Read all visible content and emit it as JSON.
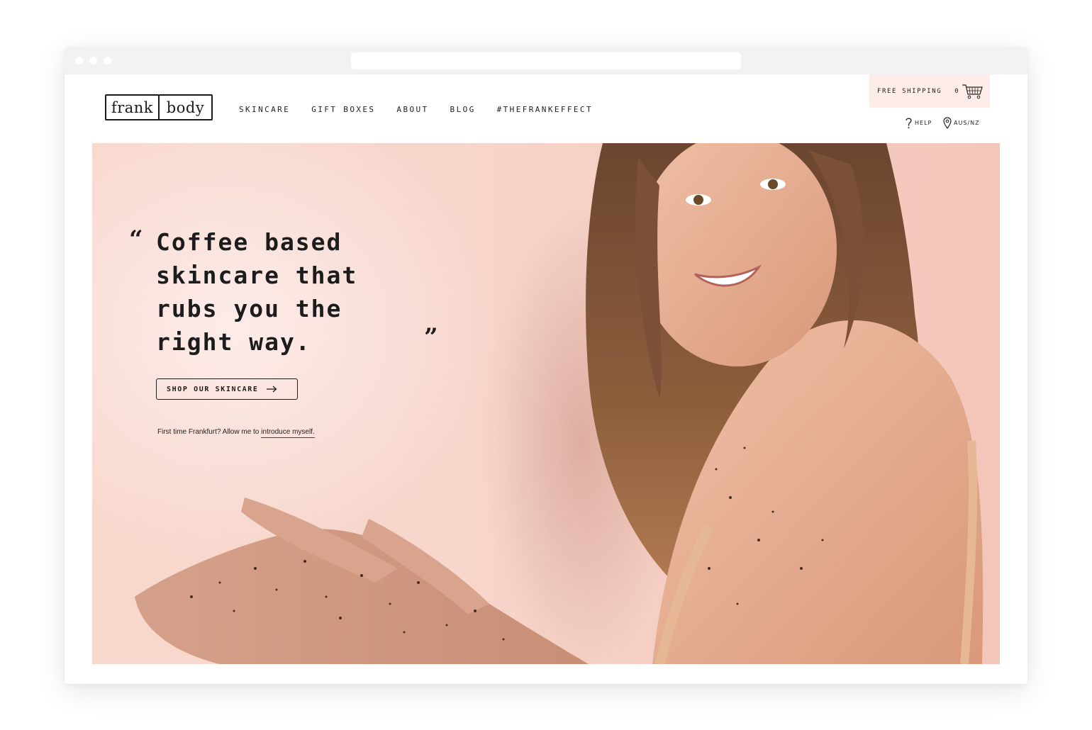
{
  "browser": {
    "address": ""
  },
  "header": {
    "logo": {
      "left": "frank",
      "right": "body"
    },
    "nav": [
      {
        "label": "SKINCARE"
      },
      {
        "label": "GIFT BOXES"
      },
      {
        "label": "ABOUT"
      },
      {
        "label": "BLOG"
      },
      {
        "label": "#THEFRANKEFFECT"
      }
    ],
    "shipping_label": "FREE SHIPPING",
    "cart_count": "0",
    "help_label": "HELP",
    "region_label": "AUS/NZ"
  },
  "hero": {
    "quote_open": "“",
    "quote_text": "Coffee based\nskincare that\nrubs you the\nright way.",
    "quote_close": "”",
    "cta_label": "SHOP OUR SKINCARE",
    "intro_text": "First time Frankfurt? Allow me to ",
    "intro_link": "introduce myself."
  },
  "colors": {
    "hero_bg": "#f7d6cc",
    "shipping_bg": "#fdecea",
    "text": "#1c1c1c"
  },
  "icons": [
    "cart-icon",
    "help-icon",
    "location-pin-icon",
    "arrow-right-icon"
  ]
}
